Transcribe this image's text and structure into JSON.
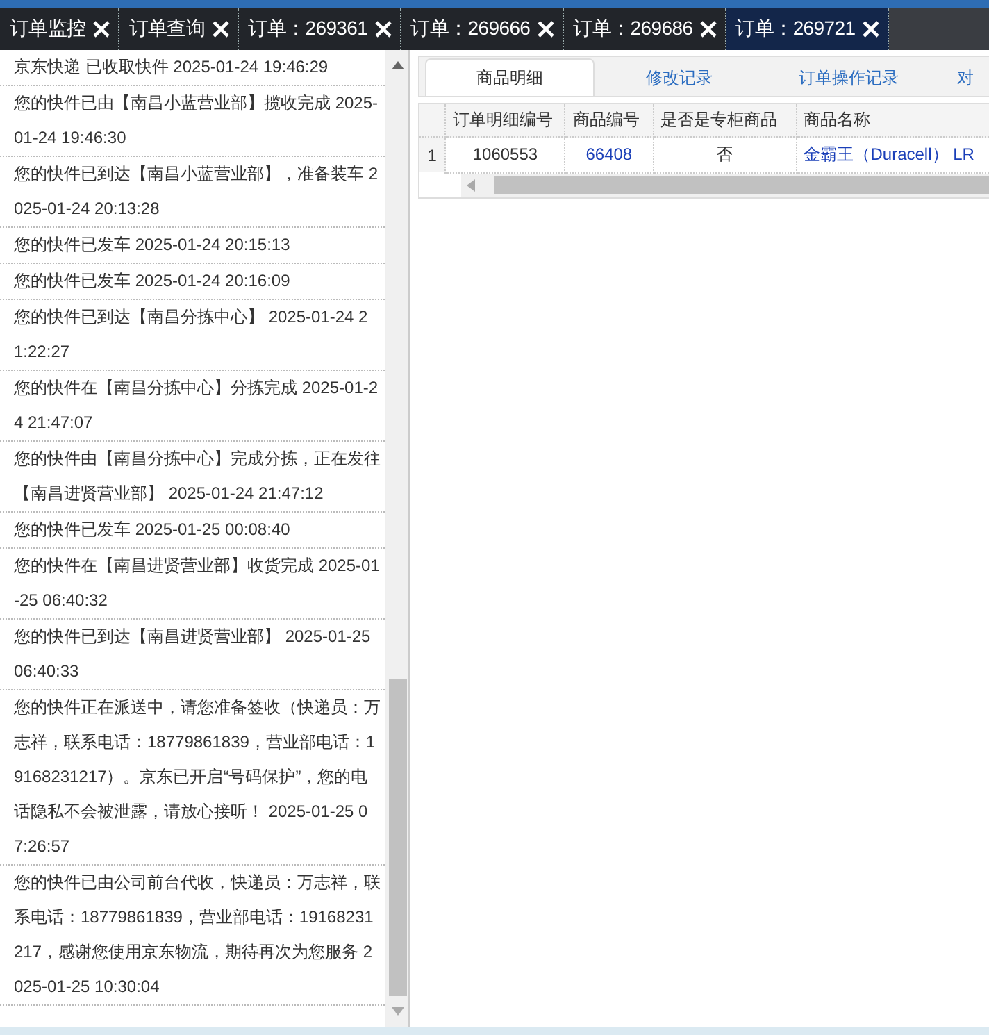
{
  "tabs": [
    {
      "label": "订单监控",
      "selected": false
    },
    {
      "label": "订单查询",
      "selected": false
    },
    {
      "label": "订单：269361",
      "selected": false
    },
    {
      "label": "订单：269666",
      "selected": false
    },
    {
      "label": "订单：269686",
      "selected": false
    },
    {
      "label": "订单：269721",
      "selected": true
    }
  ],
  "tracking_log": [
    "京东快递 已收取快件 2025-01-24 19:46:29",
    "您的快件已由【南昌小蓝营业部】揽收完成 2025-01-24 19:46:30",
    "您的快件已到达【南昌小蓝营业部】，准备装车 2025-01-24 20:13:28",
    "您的快件已发车 2025-01-24 20:15:13",
    "您的快件已发车 2025-01-24 20:16:09",
    "您的快件已到达【南昌分拣中心】 2025-01-24 21:22:27",
    "您的快件在【南昌分拣中心】分拣完成 2025-01-24 21:47:07",
    "您的快件由【南昌分拣中心】完成分拣，正在发往【南昌进贤营业部】 2025-01-24 21:47:12",
    "您的快件已发车 2025-01-25 00:08:40",
    "您的快件在【南昌进贤营业部】收货完成 2025-01-25 06:40:32",
    "您的快件已到达【南昌进贤营业部】 2025-01-25 06:40:33",
    "您的快件正在派送中，请您准备签收（快递员：万志祥，联系电话：18779861839，营业部电话：19168231217）。京东已开启“号码保护”，您的电话隐私不会被泄露，请放心接听！ 2025-01-25 07:26:57",
    "您的快件已由公司前台代收，快递员：万志祥，联系电话：18779861839，营业部电话：19168231217，感谢您使用京东物流，期待再次为您服务 2025-01-25 10:30:04"
  ],
  "detail_tabs": [
    {
      "label": "商品明细",
      "selected": true
    },
    {
      "label": "修改记录",
      "selected": false
    },
    {
      "label": "订单操作记录",
      "selected": false
    },
    {
      "label": "对",
      "selected": false
    }
  ],
  "table": {
    "columns": [
      "订单明细编号",
      "商品编号",
      "是否是专柜商品",
      "商品名称"
    ],
    "rows": [
      {
        "index": "1",
        "cells": [
          {
            "text": "1060553",
            "kind": "plain"
          },
          {
            "text": "66408",
            "kind": "link"
          },
          {
            "text": "否",
            "kind": "plain"
          },
          {
            "text": "金霸王（Duracell） LR",
            "kind": "link"
          }
        ]
      }
    ]
  }
}
